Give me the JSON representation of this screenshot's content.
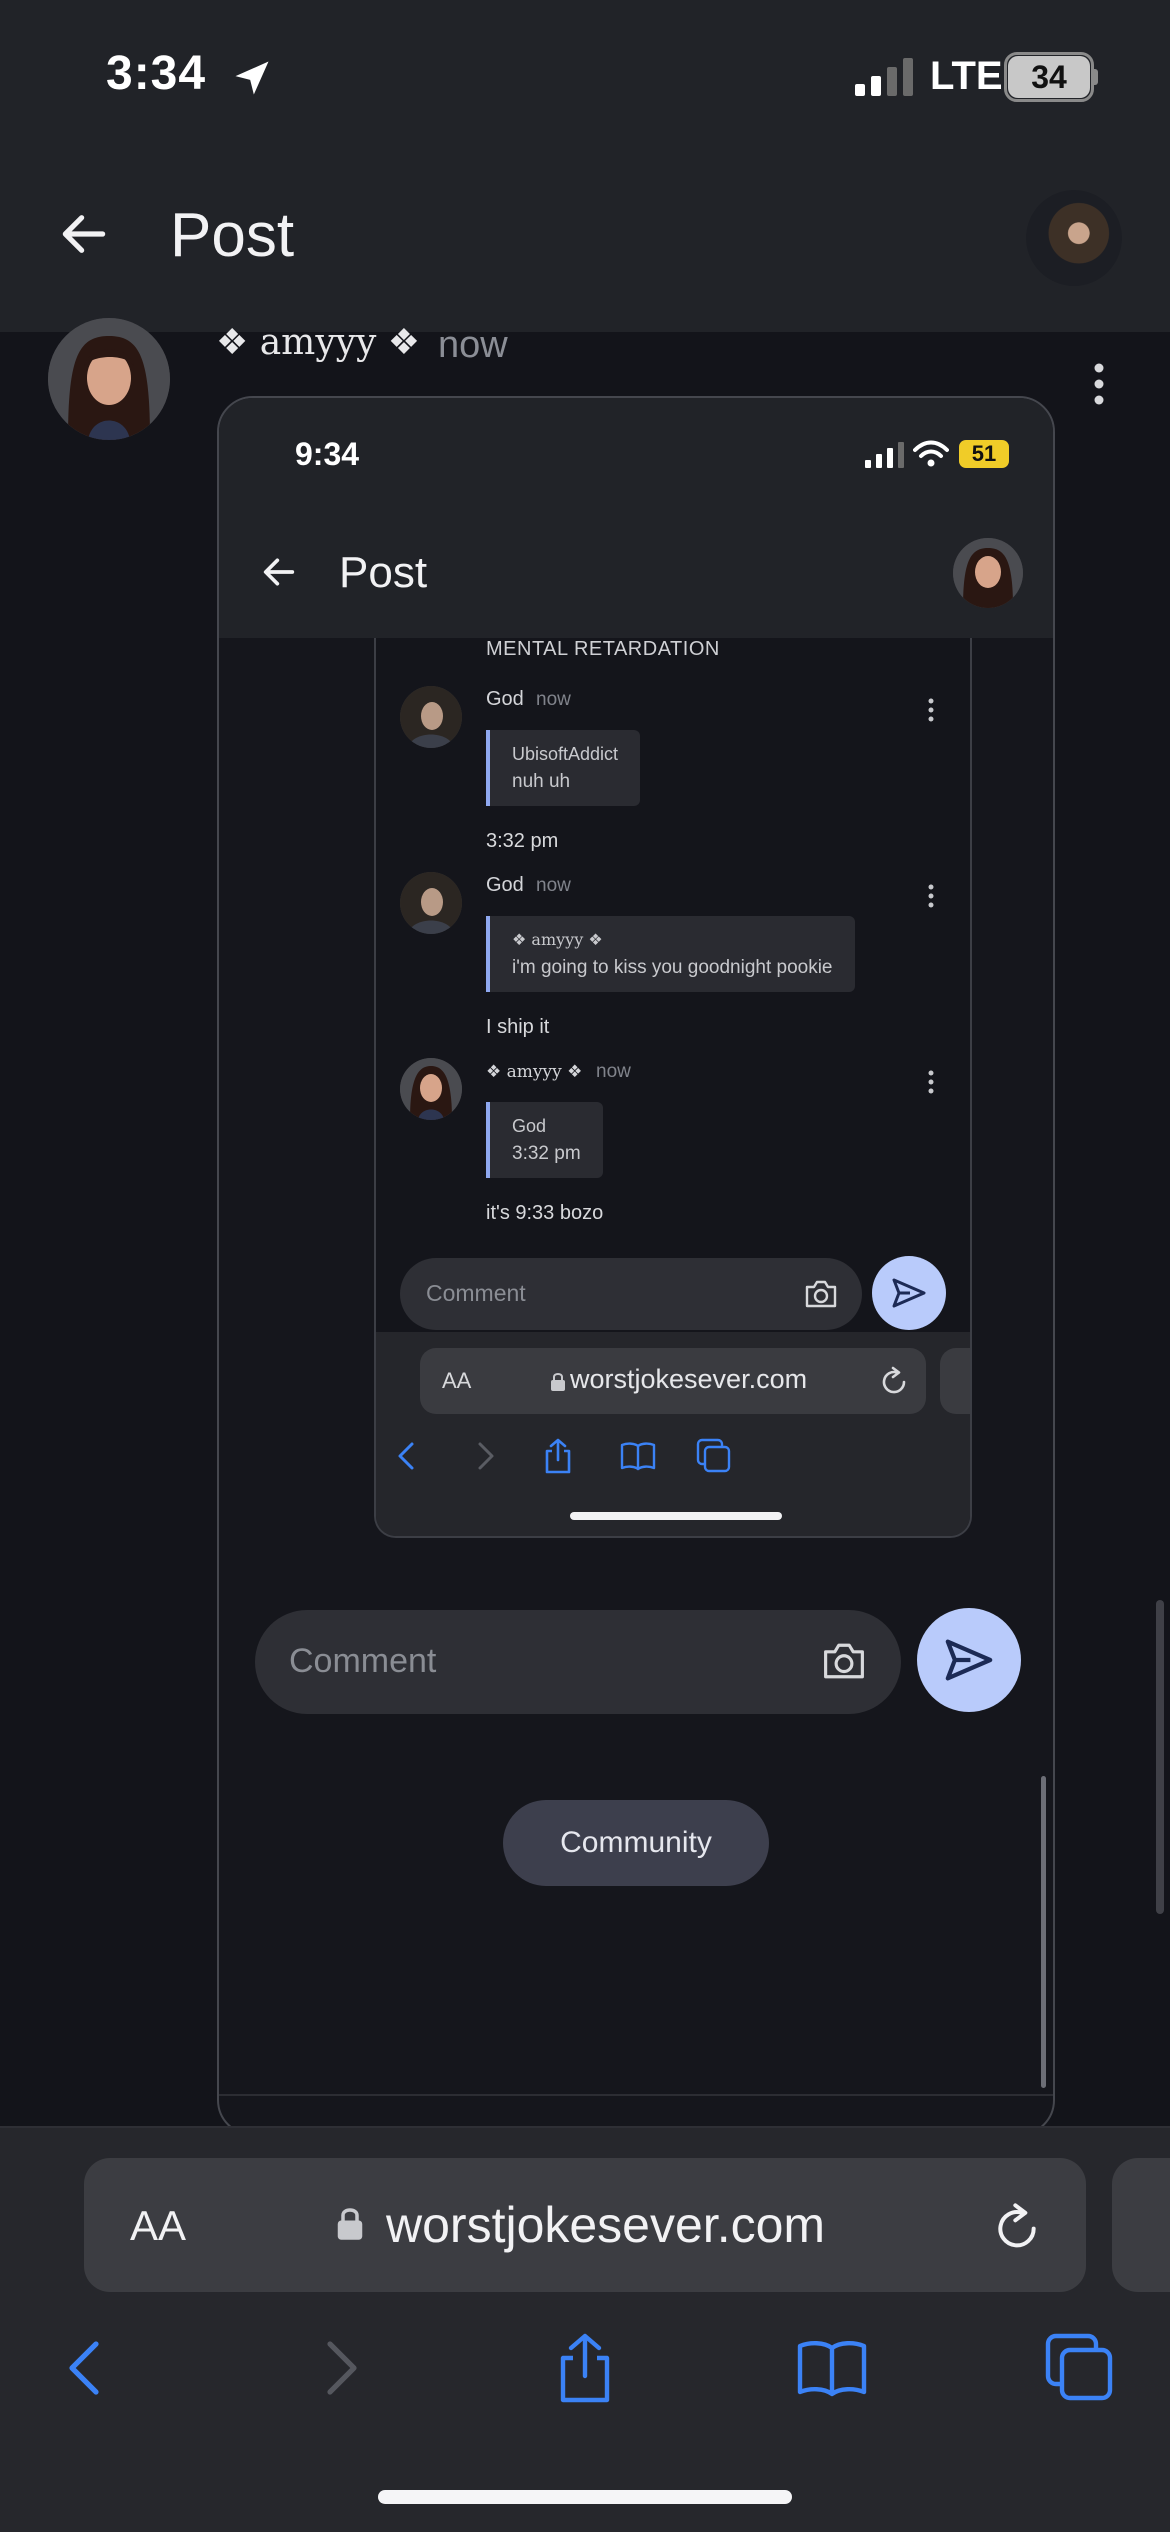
{
  "status_bar": {
    "time": "3:34",
    "network": "LTE",
    "battery": "34"
  },
  "header": {
    "title": "Post"
  },
  "post": {
    "author": "❖ amyyy ❖",
    "time": "now",
    "screenshot": {
      "status_bar": {
        "time": "9:34",
        "battery": "51"
      },
      "header": {
        "title": "Post"
      },
      "inner": {
        "top_text": "MENTAL RETARDATION",
        "comments": [
          {
            "author": "God",
            "time": "now",
            "quote_author": "UbisoftAddict",
            "quote_text": "nuh uh",
            "body": "3:32 pm"
          },
          {
            "author": "God",
            "time": "now",
            "quote_author": "❖ amyyy ❖",
            "quote_text": "i'm going to kiss you goodnight pookie",
            "body": "I ship it"
          },
          {
            "author": "❖ amyyy ❖",
            "time": "now",
            "quote_author": "God",
            "quote_text": "3:32 pm",
            "body": "it's 9:33 bozo"
          }
        ],
        "comment_placeholder": "Comment",
        "safari": {
          "aa": "AA",
          "url": "worstjokesever.com"
        }
      },
      "comment_placeholder": "Comment",
      "community_label": "Community",
      "accent_color": "#b9cbfb"
    }
  },
  "safari": {
    "aa": "AA",
    "url": "worstjokesever.com",
    "accent_color": "#3b82f6"
  }
}
